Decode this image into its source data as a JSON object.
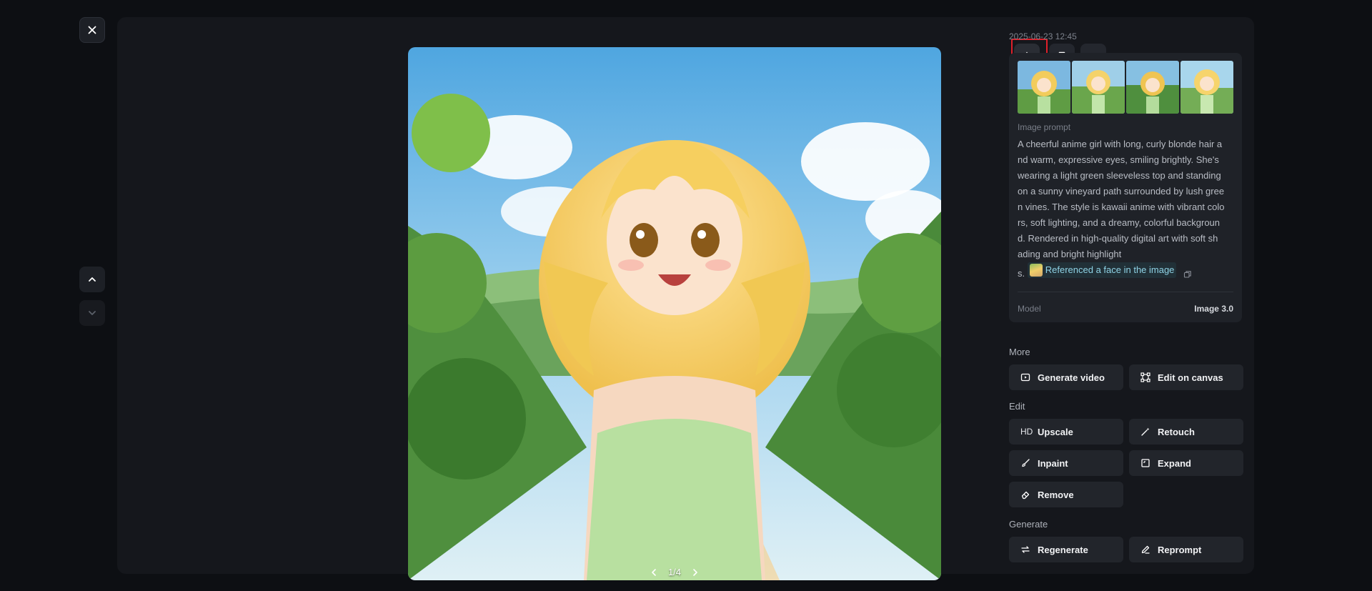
{
  "viewer": {
    "pager": "1/4"
  },
  "details": {
    "timestamp": "2025-06-23 12:45",
    "prompt_label": "Image prompt",
    "prompt_lines": [
      "A cheerful anime girl with long, curly blonde hair a",
      "nd warm, expressive eyes, smiling brightly. She's",
      "wearing a light green sleeveless top and standing",
      "on a sunny vineyard path surrounded by lush gree",
      "n vines. The style is kawaii anime with vibrant colo",
      "rs, soft lighting, and a dreamy, colorful backgroun",
      "d. Rendered in high-quality digital art with soft sh",
      "ading and bright highlight"
    ],
    "prompt_tail": "s.",
    "reference_chip": "Referenced a face in the image",
    "model_label": "Model",
    "model_value": "Image 3.0"
  },
  "sections": {
    "more": {
      "title": "More",
      "generate_video": "Generate video",
      "edit_on_canvas": "Edit on canvas"
    },
    "edit": {
      "title": "Edit",
      "hd_tag": "HD",
      "upscale": "Upscale",
      "retouch": "Retouch",
      "inpaint": "Inpaint",
      "expand": "Expand",
      "remove": "Remove"
    },
    "generate": {
      "title": "Generate",
      "regenerate": "Regenerate",
      "reprompt": "Reprompt"
    }
  },
  "colors": {
    "background": "#0d0f13",
    "panel": "#15171c",
    "card": "#1f2228",
    "button": "#22252b",
    "highlight_border": "#e0202a",
    "chip_text": "#8fd3e6"
  },
  "icons": [
    "close-icon",
    "chevron-up-icon",
    "chevron-down-icon",
    "download-icon",
    "bookmark-icon",
    "more-icon",
    "copy-icon",
    "video-icon",
    "canvas-icon",
    "magic-wand-icon",
    "brush-icon",
    "expand-icon",
    "eraser-icon",
    "refresh-icon",
    "pencil-icon"
  ]
}
